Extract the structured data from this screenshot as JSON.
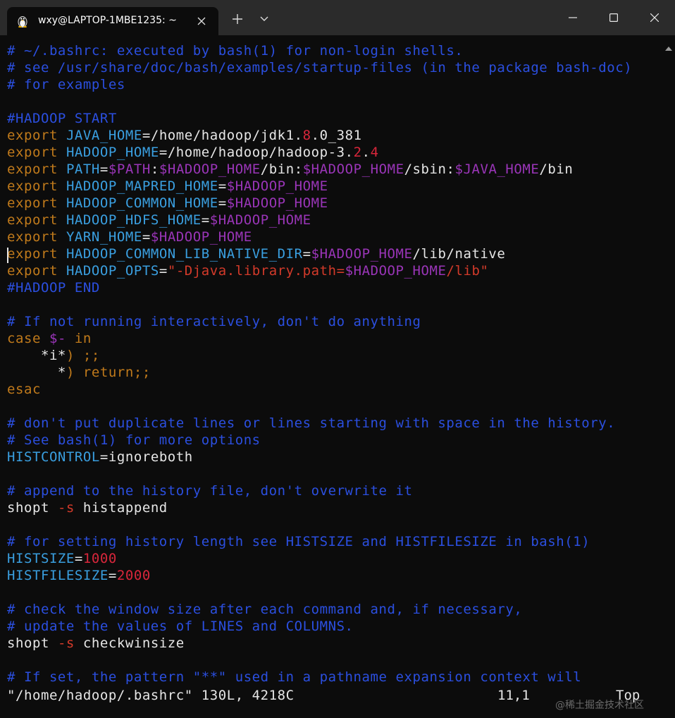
{
  "window": {
    "tab_title": "wxy@LAPTOP-1MBE1235: ~",
    "tab_icon": "linux-penguin-icon",
    "new_tab_icon": "plus-icon",
    "dropdown_icon": "chevron-down-icon",
    "close_tab_icon": "close-icon"
  },
  "editor": {
    "lines": [
      {
        "segs": [
          {
            "t": "# ~/.bashrc: executed by bash(1) for non-login shells.",
            "c": "comment"
          }
        ]
      },
      {
        "segs": [
          {
            "t": "# see /usr/share/doc/bash/examples/startup-files (in the package bash-doc)",
            "c": "comment"
          }
        ]
      },
      {
        "segs": [
          {
            "t": "# for examples",
            "c": "comment"
          }
        ]
      },
      {
        "segs": []
      },
      {
        "segs": [
          {
            "t": "#HADOOP START",
            "c": "comment"
          }
        ]
      },
      {
        "segs": [
          {
            "t": "export ",
            "c": "kw"
          },
          {
            "t": "JAVA_HOME",
            "c": "var"
          },
          {
            "t": "=/home/hadoop/jdk1.",
            "c": "white"
          },
          {
            "t": "8",
            "c": "num"
          },
          {
            "t": ".0_381",
            "c": "white"
          }
        ]
      },
      {
        "segs": [
          {
            "t": "export ",
            "c": "kw"
          },
          {
            "t": "HADOOP_HOME",
            "c": "var"
          },
          {
            "t": "=/home/hadoop/hadoop-3.",
            "c": "white"
          },
          {
            "t": "2",
            "c": "num"
          },
          {
            "t": ".",
            "c": "white"
          },
          {
            "t": "4",
            "c": "num"
          }
        ]
      },
      {
        "segs": [
          {
            "t": "export ",
            "c": "kw"
          },
          {
            "t": "PATH",
            "c": "var"
          },
          {
            "t": "=",
            "c": "white"
          },
          {
            "t": "$PATH",
            "c": "dollar"
          },
          {
            "t": ":",
            "c": "white"
          },
          {
            "t": "$HADOOP_HOME",
            "c": "dollar"
          },
          {
            "t": "/bin:",
            "c": "white"
          },
          {
            "t": "$HADOOP_HOME",
            "c": "dollar"
          },
          {
            "t": "/sbin:",
            "c": "white"
          },
          {
            "t": "$JAVA_HOME",
            "c": "dollar"
          },
          {
            "t": "/bin",
            "c": "white"
          }
        ]
      },
      {
        "segs": [
          {
            "t": "export ",
            "c": "kw"
          },
          {
            "t": "HADOOP_MAPRED_HOME",
            "c": "var"
          },
          {
            "t": "=",
            "c": "white"
          },
          {
            "t": "$HADOOP_HOME",
            "c": "dollar"
          }
        ]
      },
      {
        "segs": [
          {
            "t": "export ",
            "c": "kw"
          },
          {
            "t": "HADOOP_COMMON_HOME",
            "c": "var"
          },
          {
            "t": "=",
            "c": "white"
          },
          {
            "t": "$HADOOP_HOME",
            "c": "dollar"
          }
        ]
      },
      {
        "segs": [
          {
            "t": "export ",
            "c": "kw"
          },
          {
            "t": "HADOOP_HDFS_HOME",
            "c": "var"
          },
          {
            "t": "=",
            "c": "white"
          },
          {
            "t": "$HADOOP_HOME",
            "c": "dollar"
          }
        ]
      },
      {
        "segs": [
          {
            "t": "export ",
            "c": "kw"
          },
          {
            "t": "YARN_HOME",
            "c": "var"
          },
          {
            "t": "=",
            "c": "white"
          },
          {
            "t": "$HADOOP_HOME",
            "c": "dollar"
          }
        ]
      },
      {
        "segs": [
          {
            "t": "export ",
            "c": "kw"
          },
          {
            "t": "HADOOP_COMMON_LIB_NATIVE_DIR",
            "c": "var"
          },
          {
            "t": "=",
            "c": "white"
          },
          {
            "t": "$HADOOP_HOME",
            "c": "dollar"
          },
          {
            "t": "/lib/native",
            "c": "white"
          }
        ]
      },
      {
        "segs": [
          {
            "t": "export ",
            "c": "kw"
          },
          {
            "t": "HADOOP_OPTS",
            "c": "var"
          },
          {
            "t": "=",
            "c": "white"
          },
          {
            "t": "\"-Djava.library.path=",
            "c": "str"
          },
          {
            "t": "$HADOOP_HOME",
            "c": "dollar"
          },
          {
            "t": "/lib\"",
            "c": "str"
          }
        ]
      },
      {
        "segs": [
          {
            "t": "#HADOOP END",
            "c": "comment"
          }
        ]
      },
      {
        "segs": []
      },
      {
        "segs": [
          {
            "t": "# If not running interactively, don't do anything",
            "c": "comment"
          }
        ]
      },
      {
        "segs": [
          {
            "t": "case ",
            "c": "kw"
          },
          {
            "t": "$-",
            "c": "dollar"
          },
          {
            "t": " in",
            "c": "kw"
          }
        ]
      },
      {
        "segs": [
          {
            "t": "    *i*",
            "c": "white"
          },
          {
            "t": ") ;;",
            "c": "kw"
          }
        ]
      },
      {
        "segs": [
          {
            "t": "      *",
            "c": "white"
          },
          {
            "t": ") return;;",
            "c": "kw"
          }
        ]
      },
      {
        "segs": [
          {
            "t": "esac",
            "c": "kw"
          }
        ]
      },
      {
        "segs": []
      },
      {
        "segs": [
          {
            "t": "# don't put duplicate lines or lines starting with space in the history.",
            "c": "comment"
          }
        ]
      },
      {
        "segs": [
          {
            "t": "# See bash(1) for more options",
            "c": "comment"
          }
        ]
      },
      {
        "segs": [
          {
            "t": "HISTCONTROL",
            "c": "var"
          },
          {
            "t": "=ignoreboth",
            "c": "white"
          }
        ]
      },
      {
        "segs": []
      },
      {
        "segs": [
          {
            "t": "# append to the history file, don't overwrite it",
            "c": "comment"
          }
        ]
      },
      {
        "segs": [
          {
            "t": "shopt ",
            "c": "white"
          },
          {
            "t": "-s",
            "c": "str"
          },
          {
            "t": " histappend",
            "c": "white"
          }
        ]
      },
      {
        "segs": []
      },
      {
        "segs": [
          {
            "t": "# for setting history length see HISTSIZE and HISTFILESIZE in bash(1)",
            "c": "comment"
          }
        ]
      },
      {
        "segs": [
          {
            "t": "HISTSIZE",
            "c": "var"
          },
          {
            "t": "=",
            "c": "white"
          },
          {
            "t": "1000",
            "c": "num"
          }
        ]
      },
      {
        "segs": [
          {
            "t": "HISTFILESIZE",
            "c": "var"
          },
          {
            "t": "=",
            "c": "white"
          },
          {
            "t": "2000",
            "c": "num"
          }
        ]
      },
      {
        "segs": []
      },
      {
        "segs": [
          {
            "t": "# check the window size after each command and, if necessary,",
            "c": "comment"
          }
        ]
      },
      {
        "segs": [
          {
            "t": "# update the values of LINES and COLUMNS.",
            "c": "comment"
          }
        ]
      },
      {
        "segs": [
          {
            "t": "shopt ",
            "c": "white"
          },
          {
            "t": "-s",
            "c": "str"
          },
          {
            "t": " checkwinsize",
            "c": "white"
          }
        ]
      },
      {
        "segs": []
      },
      {
        "segs": [
          {
            "t": "# If set, the pattern \"**\" used in a pathname expansion context will",
            "c": "comment"
          }
        ]
      }
    ],
    "status_file": "\"/home/hadoop/.bashrc\" 130L, 4218C",
    "status_position": "11,1",
    "status_scroll": "Top"
  },
  "watermark": "@稀土掘金技术社区"
}
